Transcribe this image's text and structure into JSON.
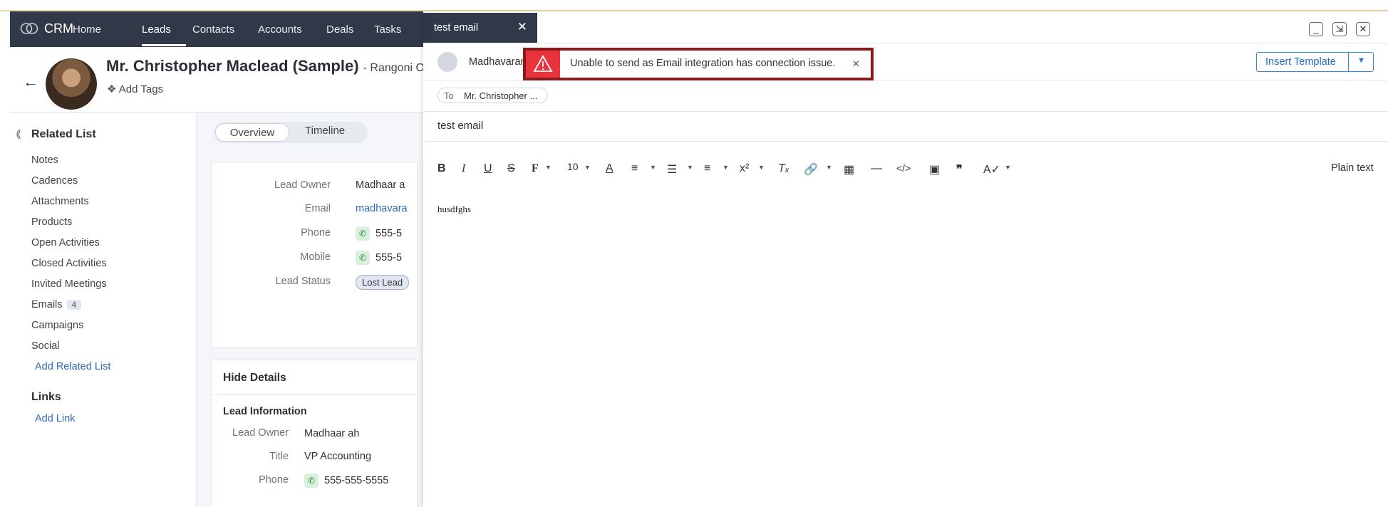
{
  "nav": {
    "brand": "CRM",
    "items": [
      "Home",
      "Leads",
      "Contacts",
      "Accounts",
      "Deals",
      "Tasks"
    ]
  },
  "lead": {
    "name": "Mr. Christopher Maclead (Sample)",
    "company": "- Rangoni Of Flo",
    "add_tags": "Add Tags"
  },
  "sidebar": {
    "title": "Related List",
    "items": [
      "Notes",
      "Cadences",
      "Attachments",
      "Products",
      "Open Activities",
      "Closed Activities",
      "Invited Meetings",
      "Emails",
      "Campaigns",
      "Social"
    ],
    "emails_count": "4",
    "add_related": "Add Related List",
    "links_title": "Links",
    "add_link": "Add Link"
  },
  "tabs": {
    "overview": "Overview",
    "timeline": "Timeline"
  },
  "card1": {
    "lead_owner_label": "Lead Owner",
    "lead_owner": "Madhaar a",
    "email_label": "Email",
    "email": "madhavara",
    "phone_label": "Phone",
    "phone": "555-5",
    "mobile_label": "Mobile",
    "mobile": "555-5",
    "status_label": "Lead Status",
    "status": "Lost Lead"
  },
  "card2": {
    "hide_details": "Hide Details",
    "section": "Lead Information",
    "owner_label": "Lead Owner",
    "owner": "Madhaar ah",
    "title_label": "Title",
    "title": "VP Accounting",
    "phone_label": "Phone",
    "phone": "555-555-5555"
  },
  "composer": {
    "tab_title": "test email",
    "from": "Madhavaran",
    "insert_template": "Insert Template",
    "to_label": "To",
    "to_recipient": "Mr. Christopher ...",
    "subject": "test email",
    "font_size": "10",
    "plain_text": "Plain text",
    "body": "husdfghs"
  },
  "toast": {
    "message": "Unable to send as Email integration has connection issue."
  },
  "colors": {
    "nav_bg": "#313949",
    "error_red": "#e8333c",
    "toast_border": "#8b1b1b",
    "link_blue": "#2f6bb5"
  }
}
